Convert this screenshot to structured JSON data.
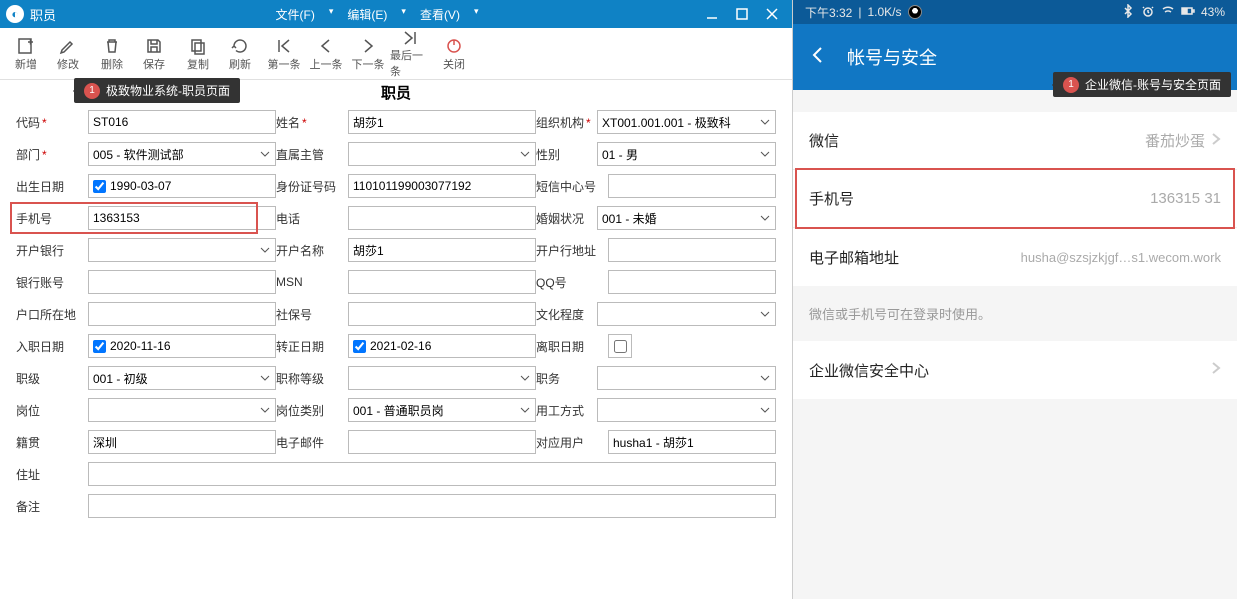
{
  "left": {
    "title": "职员",
    "menus": {
      "file": "文件(F)",
      "edit": "编辑(E)",
      "view": "查看(V)"
    },
    "toolbar": {
      "new": "新增",
      "edit": "修改",
      "delete": "删除",
      "save": "保存",
      "copy": "复制",
      "refresh": "刷新",
      "first": "第一条",
      "prev": "上一条",
      "next": "下一条",
      "last": "最后一条",
      "close": "关闭"
    },
    "annot": "极致物业系统-职员页面",
    "formTitle": "职员",
    "fields": {
      "code": {
        "label": "代码",
        "value": "ST016"
      },
      "name": {
        "label": "姓名",
        "value": "胡莎1"
      },
      "org": {
        "label": "组织机构",
        "value": "XT001.001.001 - 极致科"
      },
      "dept": {
        "label": "部门",
        "value": "005 - 软件测试部"
      },
      "manager": {
        "label": "直属主管",
        "value": ""
      },
      "gender": {
        "label": "性别",
        "value": "01 - 男"
      },
      "birth": {
        "label": "出生日期",
        "value": "1990-03-07"
      },
      "idno": {
        "label": "身份证号码",
        "value": "110101199003077192"
      },
      "smscenter": {
        "label": "短信中心号",
        "value": ""
      },
      "phone": {
        "label": "手机号",
        "value": "1363153"
      },
      "tel": {
        "label": "电话",
        "value": ""
      },
      "marital": {
        "label": "婚姻状况",
        "value": "001 - 未婚"
      },
      "bank": {
        "label": "开户银行",
        "value": ""
      },
      "acctname": {
        "label": "开户名称",
        "value": "胡莎1"
      },
      "bankaddr": {
        "label": "开户行地址",
        "value": ""
      },
      "bankacct": {
        "label": "银行账号",
        "value": ""
      },
      "msn": {
        "label": "MSN",
        "value": ""
      },
      "qq": {
        "label": "QQ号",
        "value": ""
      },
      "hukou": {
        "label": "户口所在地",
        "value": ""
      },
      "ssn": {
        "label": "社保号",
        "value": ""
      },
      "edu": {
        "label": "文化程度",
        "value": ""
      },
      "hiredate": {
        "label": "入职日期",
        "value": "2020-11-16"
      },
      "regdate": {
        "label": "转正日期",
        "value": "2021-02-16"
      },
      "leavedate": {
        "label": "离职日期",
        "value": ""
      },
      "rank": {
        "label": "职级",
        "value": "001 - 初级"
      },
      "title": {
        "label": "职称等级",
        "value": ""
      },
      "duty": {
        "label": "职务",
        "value": ""
      },
      "post": {
        "label": "岗位",
        "value": ""
      },
      "posttype": {
        "label": "岗位类别",
        "value": "001 - 普通职员岗"
      },
      "employtype": {
        "label": "用工方式",
        "value": ""
      },
      "native": {
        "label": "籍贯",
        "value": "深圳"
      },
      "email": {
        "label": "电子邮件",
        "value": ""
      },
      "user": {
        "label": "对应用户",
        "value": "husha1 - 胡莎1"
      },
      "address": {
        "label": "住址",
        "value": ""
      },
      "remark": {
        "label": "备注",
        "value": ""
      }
    }
  },
  "right": {
    "status": {
      "time": "下午3:32",
      "speed": "1.0K/s",
      "battery": "43%"
    },
    "header": "帐号与安全",
    "annot": "企业微信-账号与安全页面",
    "items": {
      "weixin": {
        "label": "微信",
        "value": "番茄炒蛋"
      },
      "phone": {
        "label": "手机号",
        "value": "136315     31"
      },
      "email": {
        "label": "电子邮箱地址",
        "value": "husha@szsjzkjgf…s1.wecom.work"
      },
      "security": {
        "label": "企业微信安全中心",
        "value": ""
      }
    },
    "note": "微信或手机号可在登录时使用。"
  }
}
